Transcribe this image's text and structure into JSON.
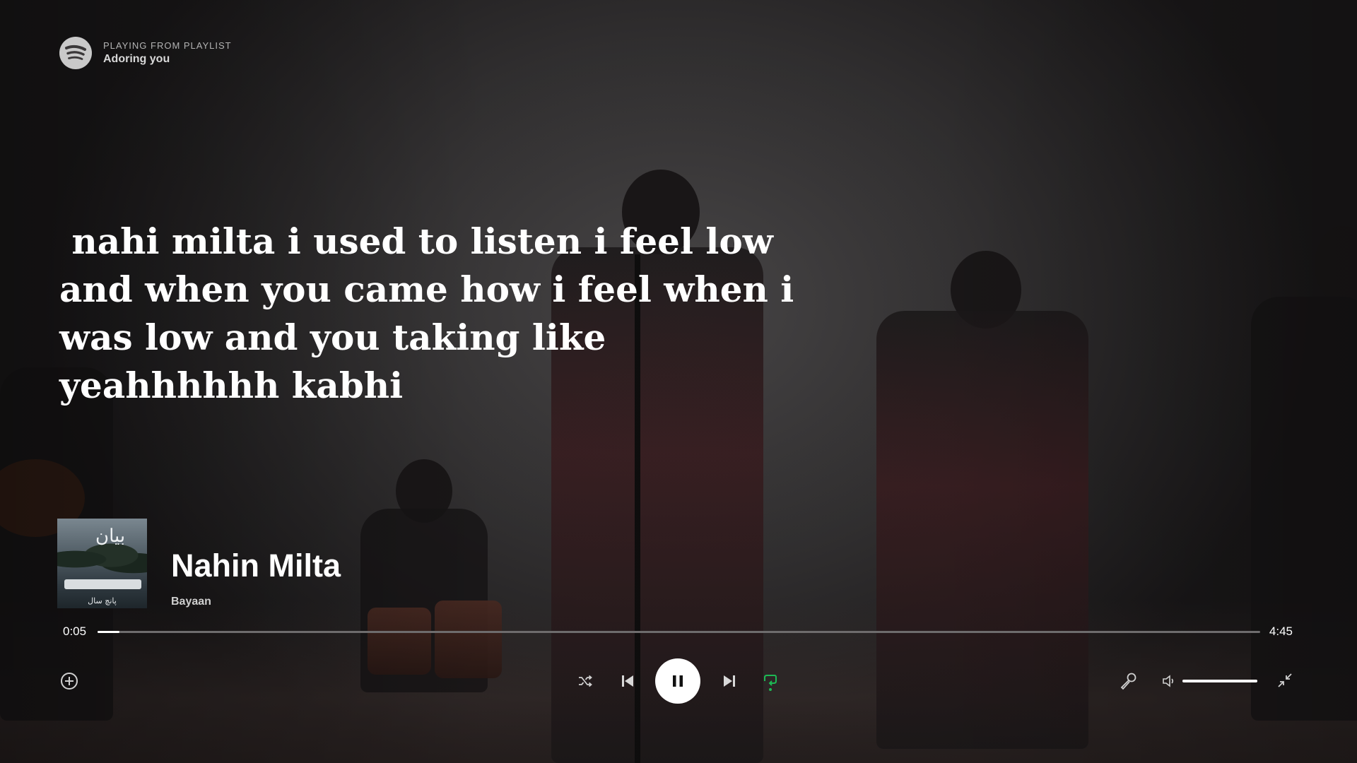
{
  "header": {
    "playing_from_label": "PLAYING FROM PLAYLIST",
    "playlist_name": "Adoring you"
  },
  "lyrics": {
    "current_line": " nahi milta i used to listen i feel low\nand when you came how i feel when i\nwas low and you taking like\nyeahhhhhh kabhi"
  },
  "track": {
    "title": "Nahin Milta",
    "artist": "Bayaan",
    "cover_caption": "پانچ سال",
    "cover_glyph": "بیان"
  },
  "playback": {
    "current_time": "0:05",
    "total_time": "4:45",
    "progress_fraction": 0.019,
    "volume_fraction": 1.0,
    "is_playing": true,
    "repeat_enabled": true,
    "shuffle_enabled": false
  },
  "colors": {
    "accent": "#1db954",
    "text_primary": "#ffffff",
    "text_secondary": "#b3b3b3"
  },
  "icons": {
    "logo": "spotify-logo-icon",
    "add": "add-circle-icon",
    "shuffle": "shuffle-icon",
    "previous": "skip-previous-icon",
    "pause": "pause-icon",
    "next": "skip-next-icon",
    "repeat": "repeat-icon",
    "lyrics": "microphone-icon",
    "volume": "volume-icon",
    "exit_fullscreen": "minimize-icon"
  }
}
